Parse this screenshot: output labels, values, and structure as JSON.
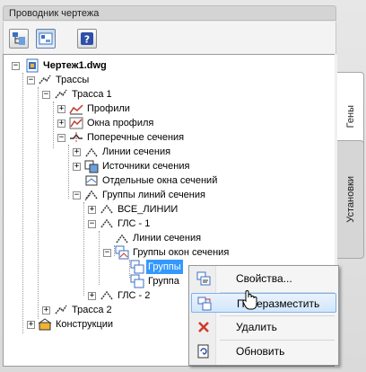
{
  "window": {
    "title": "Проводник чертежа"
  },
  "tabs": [
    {
      "label": "Гены",
      "active": true
    },
    {
      "label": "Установки",
      "active": false
    }
  ],
  "toolbar": {
    "buttons": [
      "tree-view-icon",
      "list-view-icon",
      "help-icon"
    ]
  },
  "tree": {
    "drawing": "Чертеж1.dwg",
    "routes": "Трассы",
    "route1": "Трасса 1",
    "profiles": "Профили",
    "profile_windows": "Окна профиля",
    "cross_sections": "Поперечные сечения",
    "section_lines": "Линии сечения",
    "section_sources": "Источники сечения",
    "separate_windows": "Отдельные окна сечений",
    "line_groups": "Группы линий сечения",
    "all_lines": "ВСЕ_ЛИНИИ",
    "gls1": "ГЛС - 1",
    "gls1_lines": "Линии сечения",
    "window_groups": "Группы окон сечения",
    "group_a": "Группы",
    "group_b": "Группа",
    "gls2": "ГЛС - 2",
    "route2": "Трасса 2",
    "structures": "Конструкции"
  },
  "context_menu": {
    "properties": "Свойства...",
    "rearrange": "Переразместить",
    "delete": "Удалить",
    "refresh": "Обновить"
  },
  "colors": {
    "selection": "#3399ff",
    "menu_highlight": "#d2e6fb"
  }
}
